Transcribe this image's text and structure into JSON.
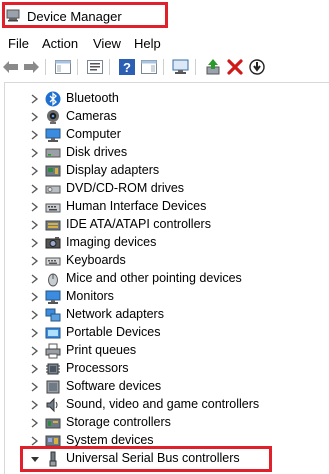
{
  "window": {
    "title": "Device Manager"
  },
  "menu": {
    "items": [
      {
        "label": "File"
      },
      {
        "label": "Action"
      },
      {
        "label": "View"
      },
      {
        "label": "Help"
      }
    ]
  },
  "toolbar": {
    "buttons": [
      {
        "icon": "back-arrow-icon"
      },
      {
        "icon": "forward-arrow-icon"
      },
      {
        "icon": "show-hide-console-tree-icon"
      },
      {
        "icon": "properties-icon"
      },
      {
        "icon": "help-icon"
      },
      {
        "icon": "action-pane-icon"
      },
      {
        "icon": "scan-for-hardware-icon"
      },
      {
        "icon": "update-driver-icon"
      },
      {
        "icon": "uninstall-device-icon"
      },
      {
        "icon": "disable-device-icon"
      }
    ]
  },
  "tree": {
    "items": [
      {
        "label": "Bluetooth",
        "icon": "bluetooth-icon",
        "expanded": false
      },
      {
        "label": "Cameras",
        "icon": "camera-icon",
        "expanded": false
      },
      {
        "label": "Computer",
        "icon": "computer-icon",
        "expanded": false
      },
      {
        "label": "Disk drives",
        "icon": "disk-drive-icon",
        "expanded": false
      },
      {
        "label": "Display adapters",
        "icon": "display-adapter-icon",
        "expanded": false
      },
      {
        "label": "DVD/CD-ROM drives",
        "icon": "dvd-drive-icon",
        "expanded": false
      },
      {
        "label": "Human Interface Devices",
        "icon": "hid-icon",
        "expanded": false
      },
      {
        "label": "IDE ATA/ATAPI controllers",
        "icon": "ide-controller-icon",
        "expanded": false
      },
      {
        "label": "Imaging devices",
        "icon": "imaging-device-icon",
        "expanded": false
      },
      {
        "label": "Keyboards",
        "icon": "keyboard-icon",
        "expanded": false
      },
      {
        "label": "Mice and other pointing devices",
        "icon": "mouse-icon",
        "expanded": false
      },
      {
        "label": "Monitors",
        "icon": "monitor-icon",
        "expanded": false
      },
      {
        "label": "Network adapters",
        "icon": "network-adapter-icon",
        "expanded": false
      },
      {
        "label": "Portable Devices",
        "icon": "portable-device-icon",
        "expanded": false
      },
      {
        "label": "Print queues",
        "icon": "printer-icon",
        "expanded": false
      },
      {
        "label": "Processors",
        "icon": "processor-icon",
        "expanded": false
      },
      {
        "label": "Software devices",
        "icon": "software-device-icon",
        "expanded": false
      },
      {
        "label": "Sound, video and game controllers",
        "icon": "speaker-icon",
        "expanded": false
      },
      {
        "label": "Storage controllers",
        "icon": "storage-controller-icon",
        "expanded": false
      },
      {
        "label": "System devices",
        "icon": "system-device-icon",
        "expanded": false
      },
      {
        "label": "Universal Serial Bus controllers",
        "icon": "usb-icon",
        "expanded": true
      }
    ]
  },
  "colors": {
    "highlight_border": "#e0202a",
    "help_blue": "#2b5fb4",
    "delete_red": "#d01818",
    "green_arrow": "#2a9a2a"
  }
}
